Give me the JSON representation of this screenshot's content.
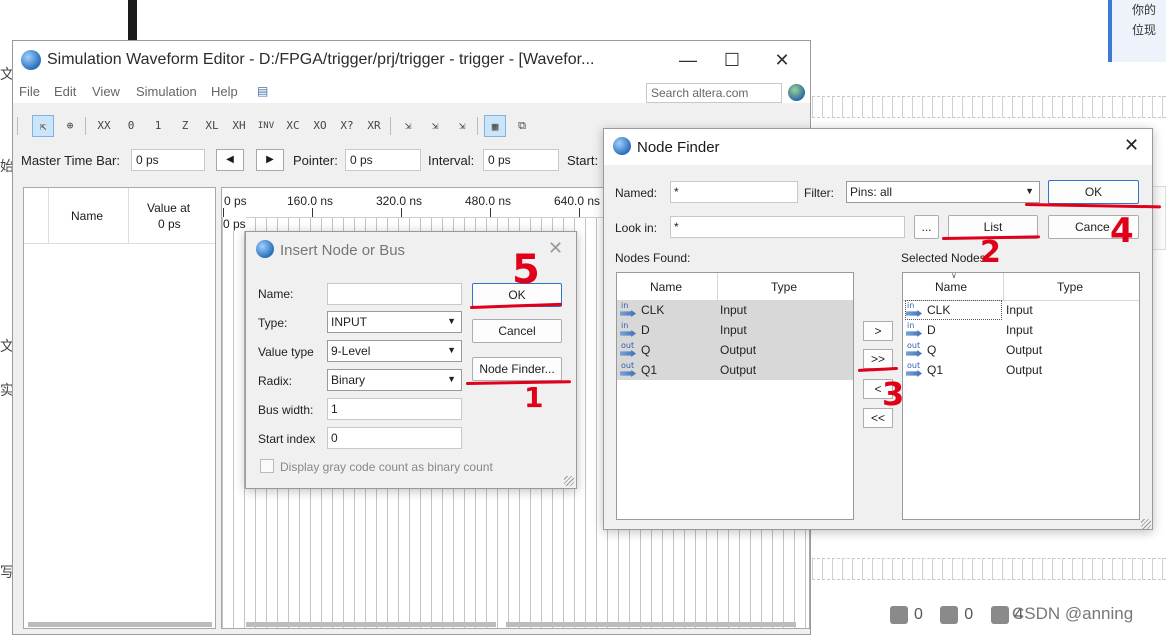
{
  "background": {
    "card_lines": [
      "你的",
      "位现"
    ],
    "left_chars": [
      "文",
      "始",
      "文",
      "实",
      "写"
    ],
    "csdn": {
      "like_count": "0",
      "dislike_count": "0",
      "fav_count": "4",
      "watermark": "CSDN @anning"
    }
  },
  "main_window": {
    "title": "Simulation Waveform Editor - D:/FPGA/trigger/prj/trigger - trigger - [Wavefor...",
    "menu": [
      "File",
      "Edit",
      "View",
      "Simulation",
      "Help"
    ],
    "search_placeholder": "Search altera.com",
    "toolbar_glyphs": [
      "⇱",
      "⊕",
      "XX",
      "0",
      "1",
      "Z",
      "XL",
      "XH",
      "INV",
      "XC",
      "XO",
      "X?",
      "XR",
      "⇲",
      "⇲",
      "⇲",
      "▦",
      "⧉"
    ],
    "timebar": {
      "master_label": "Master Time Bar:",
      "master_value": "0 ps",
      "pointer_label": "Pointer:",
      "pointer_value": "0 ps",
      "interval_label": "Interval:",
      "interval_value": "0 ps",
      "start_label": "Start:"
    },
    "name_panel": {
      "name_header": "Name",
      "value_header_line1": "Value at",
      "value_header_line2": "0 ps"
    },
    "ruler": {
      "labels": [
        "0 ps",
        "160.0 ns",
        "320.0 ns",
        "480.0 ns",
        "640.0 ns"
      ],
      "sub_label": "0 ps"
    }
  },
  "insert_dialog": {
    "title": "Insert Node or Bus",
    "name_label": "Name:",
    "name_value": "",
    "type_label": "Type:",
    "type_value": "INPUT",
    "value_type_label": "Value type",
    "value_type_value": "9-Level",
    "radix_label": "Radix:",
    "radix_value": "Binary",
    "bus_width_label": "Bus width:",
    "bus_width_value": "1",
    "start_index_label": "Start index",
    "start_index_value": "0",
    "gray_code_label": "Display gray code count as binary count",
    "ok_label": "OK",
    "cancel_label": "Cancel",
    "node_finder_label": "Node Finder..."
  },
  "node_finder": {
    "title": "Node Finder",
    "named_label": "Named:",
    "named_value": "*",
    "filter_label": "Filter:",
    "filter_value": "Pins: all",
    "look_in_label": "Look in:",
    "look_in_value": "*",
    "browse_label": "...",
    "list_label": "List",
    "ok_label": "OK",
    "cancel_label": "Cance",
    "nodes_found_label": "Nodes Found:",
    "selected_nodes_label": "Selected Nodes:",
    "col_name": "Name",
    "col_type": "Type",
    "found": [
      {
        "dir": "in",
        "name": "CLK",
        "type": "Input"
      },
      {
        "dir": "in",
        "name": "D",
        "type": "Input"
      },
      {
        "dir": "out",
        "name": "Q",
        "type": "Output"
      },
      {
        "dir": "out",
        "name": "Q1",
        "type": "Output"
      }
    ],
    "selected": [
      {
        "dir": "in",
        "name": "CLK",
        "type": "Input"
      },
      {
        "dir": "in",
        "name": "D",
        "type": "Input"
      },
      {
        "dir": "out",
        "name": "Q",
        "type": "Output"
      },
      {
        "dir": "out",
        "name": "Q1",
        "type": "Output"
      }
    ],
    "move_buttons": [
      ">",
      ">>",
      "<",
      "<<"
    ]
  },
  "annotations": {
    "n1": "1",
    "n2": "2",
    "n3": "3",
    "n4": "4",
    "n5": "5",
    "color": "#e0001a"
  }
}
